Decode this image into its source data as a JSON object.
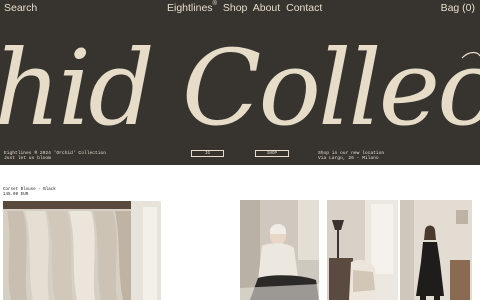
{
  "nav": {
    "search": "Search",
    "brand": "Eightlines",
    "brand_mark": "®",
    "shop": "Shop",
    "about": "About",
    "contact": "Contact",
    "bag": "Bag (0)"
  },
  "hero": {
    "title_partial": "hid Collection",
    "foot_left_line1": "Eightlines ® 2024 'Orchid' Collection",
    "foot_left_line2": "Just let us bloom",
    "ig_button": "IG",
    "shop_button": "SHOP",
    "foot_right_line1": "Shop in our new location",
    "foot_right_line2": "Via Largo, 26 - Milano"
  },
  "product": {
    "name": "Corset Blouse - Black",
    "price": "145.00 EUR"
  },
  "colors": {
    "hero_bg": "#373430",
    "hero_text": "#e6dcc8"
  }
}
